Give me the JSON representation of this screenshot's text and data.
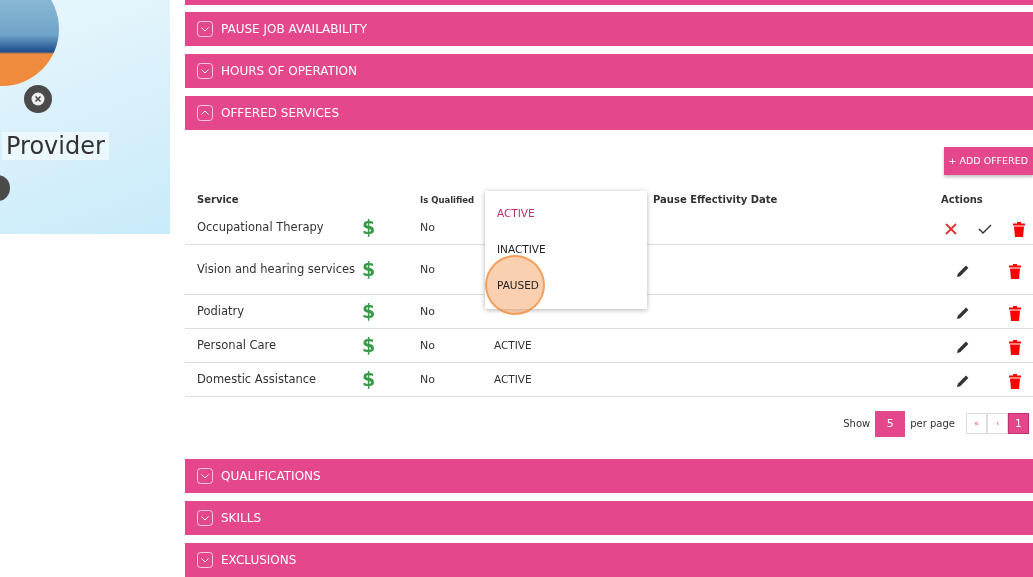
{
  "profile": {
    "name": "Provider"
  },
  "sections_top": [
    {
      "title": "PAUSE JOB AVAILABILITY",
      "expanded": false
    },
    {
      "title": "HOURS OF OPERATION",
      "expanded": false
    },
    {
      "title": "OFFERED SERVICES",
      "expanded": true
    }
  ],
  "offered_services": {
    "add_button": "+ ADD OFFERED",
    "columns": {
      "service": "Service",
      "is_qualified": "Is Qualified",
      "pause_date": "Pause Effectivity Date",
      "actions": "Actions"
    },
    "rows": [
      {
        "service": "Occupational Therapy",
        "price_icon": "$",
        "is_qualified": "No",
        "kind": "editing"
      },
      {
        "service": "Vision and hearing services",
        "price_icon": "$",
        "is_qualified": "No",
        "kind": "view"
      },
      {
        "service": "Podiatry",
        "price_icon": "$",
        "is_qualified": "No",
        "kind": "view"
      },
      {
        "service": "Personal Care",
        "price_icon": "$",
        "is_qualified": "No",
        "status": "ACTIVE",
        "kind": "view"
      },
      {
        "service": "Domestic Assistance",
        "price_icon": "$",
        "is_qualified": "No",
        "status": "ACTIVE",
        "kind": "view"
      }
    ],
    "status_dropdown": [
      {
        "label": "ACTIVE",
        "selected": true,
        "hovered": false
      },
      {
        "label": "INACTIVE",
        "selected": false,
        "hovered": false
      },
      {
        "label": "PAUSED",
        "selected": false,
        "hovered": true
      }
    ],
    "pagination": {
      "show_label": "Show",
      "page_size": "5",
      "per_page_label": "per page",
      "first": "«",
      "prev": "‹",
      "pages": [
        {
          "label": "1",
          "selected": true
        }
      ]
    }
  },
  "sections_bottom": [
    {
      "title": "QUALIFICATIONS",
      "expanded": false
    },
    {
      "title": "SKILLS",
      "expanded": false
    },
    {
      "title": "EXCLUSIONS",
      "expanded": false
    }
  ]
}
